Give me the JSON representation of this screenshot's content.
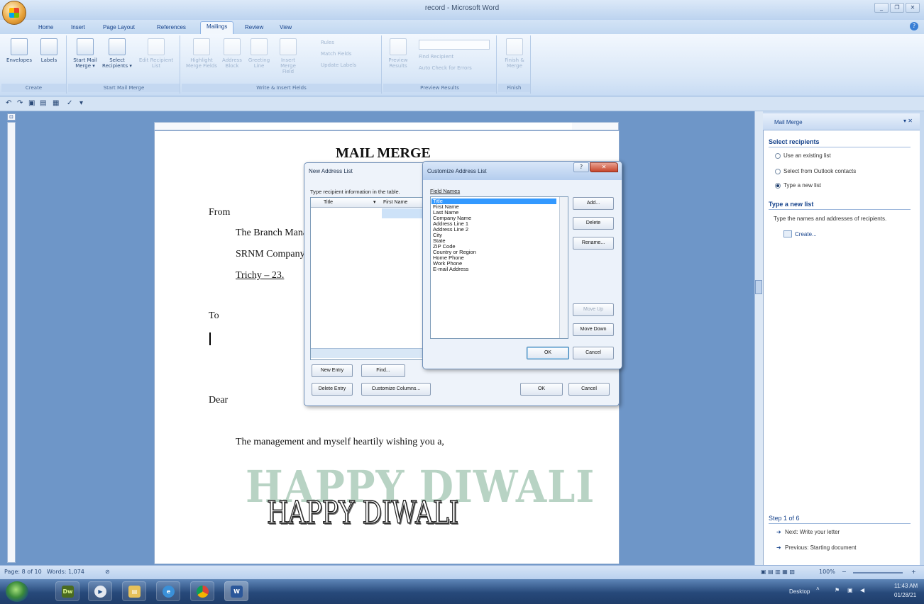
{
  "window": {
    "title": "record - Microsoft Word",
    "controls": [
      "_",
      "❐",
      "✕"
    ]
  },
  "tabs": [
    {
      "label": "Home"
    },
    {
      "label": "Insert"
    },
    {
      "label": "Page Layout"
    },
    {
      "label": "References"
    },
    {
      "label": "Mailings",
      "active": true
    },
    {
      "label": "Review"
    },
    {
      "label": "View"
    }
  ],
  "ribbon": {
    "create": {
      "label": "Create",
      "envelopes": "Envelopes",
      "labels": "Labels"
    },
    "start": {
      "label": "Start Mail Merge",
      "start_merge": "Start Mail Merge ▾",
      "select": "Select Recipients ▾",
      "edit": "Edit Recipient List"
    },
    "write": {
      "label": "Write & Insert Fields",
      "highlight": "Highlight Merge Fields",
      "address": "Address Block",
      "greeting": "Greeting Line",
      "insert": "Insert Merge Field",
      "rules": "Rules",
      "match": "Match Fields",
      "update": "Update Labels"
    },
    "preview": {
      "label": "Preview Results",
      "preview": "Preview Results",
      "find": "Find Recipient",
      "auto": "Auto Check for Errors"
    },
    "finish": {
      "label": "Finish",
      "finish": "Finish & Merge"
    }
  },
  "document": {
    "heading": "MAIL MERGE",
    "from": "From",
    "addr1": "The Branch Manager,",
    "addr2": "SRNM Company,",
    "addr3": "Trichy – 23.",
    "to": "To",
    "dear": "Dear",
    "body": "The management and myself heartily wishing you a,",
    "art_shadow": "HAPPY DIWALI",
    "art_main": "HAPPY DIWALI"
  },
  "new_address_list": {
    "title": "New Address List",
    "instruction": "Type recipient information in the table.",
    "columns": [
      "Title",
      "First Name"
    ],
    "new_entry": "New Entry",
    "find": "Find...",
    "delete_entry": "Delete Entry",
    "customize": "Customize Columns...",
    "ok": "OK",
    "cancel": "Cancel"
  },
  "customize_dialog": {
    "title": "Customize Address List",
    "field_names_label": "Field Names",
    "fields": [
      "Title",
      "First Name",
      "Last Name",
      "Company Name",
      "Address Line 1",
      "Address Line 2",
      "City",
      "State",
      "ZIP Code",
      "Country or Region",
      "Home Phone",
      "Work Phone",
      "E-mail Address"
    ],
    "selected_field": "Title",
    "add": "Add...",
    "delete": "Delete",
    "rename": "Rename...",
    "move_up": "Move Up",
    "move_down": "Move Down",
    "ok": "OK",
    "cancel": "Cancel"
  },
  "task_pane": {
    "title": "Mail Merge",
    "select_heading": "Select recipients",
    "options": [
      {
        "label": "Use an existing list",
        "selected": false
      },
      {
        "label": "Select from Outlook contacts",
        "selected": false
      },
      {
        "label": "Type a new list",
        "selected": true
      }
    ],
    "type_heading": "Type a new list",
    "type_desc": "Type the names and addresses of recipients.",
    "create_link": "Create...",
    "step": "Step 1 of 6",
    "next": "Next: Write your letter",
    "prev": "Previous: Starting document"
  },
  "status_bar": {
    "page": "Page: 8 of 10",
    "words": "Words: 1,074",
    "zoom": "100%"
  },
  "taskbar": {
    "desktop": "Desktop",
    "time": "11:43 AM",
    "date": "01/28/21"
  }
}
